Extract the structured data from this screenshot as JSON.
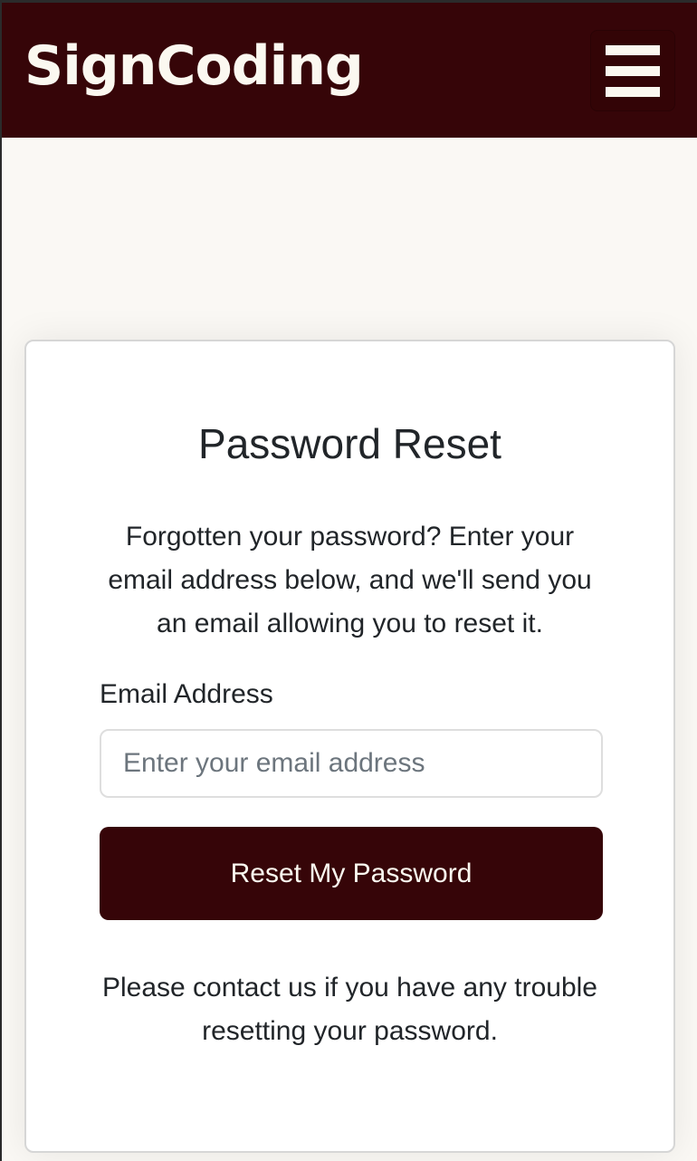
{
  "navbar": {
    "brand": "SignCoding",
    "menu_icon": "hamburger-menu-icon",
    "background_color": "#360508",
    "text_color": "#fbf8f0"
  },
  "card": {
    "title": "Password Reset",
    "intro": "Forgotten your password? Enter your email address below, and we'll send you an email allowing you to reset it.",
    "email_label": "Email Address",
    "email_value": "",
    "email_placeholder": "Enter your email address",
    "submit_label": "Reset My Password",
    "footer": "Please contact us if you have any trouble resetting your password."
  },
  "colors": {
    "page_background": "#faf8f4",
    "accent": "#360508"
  }
}
